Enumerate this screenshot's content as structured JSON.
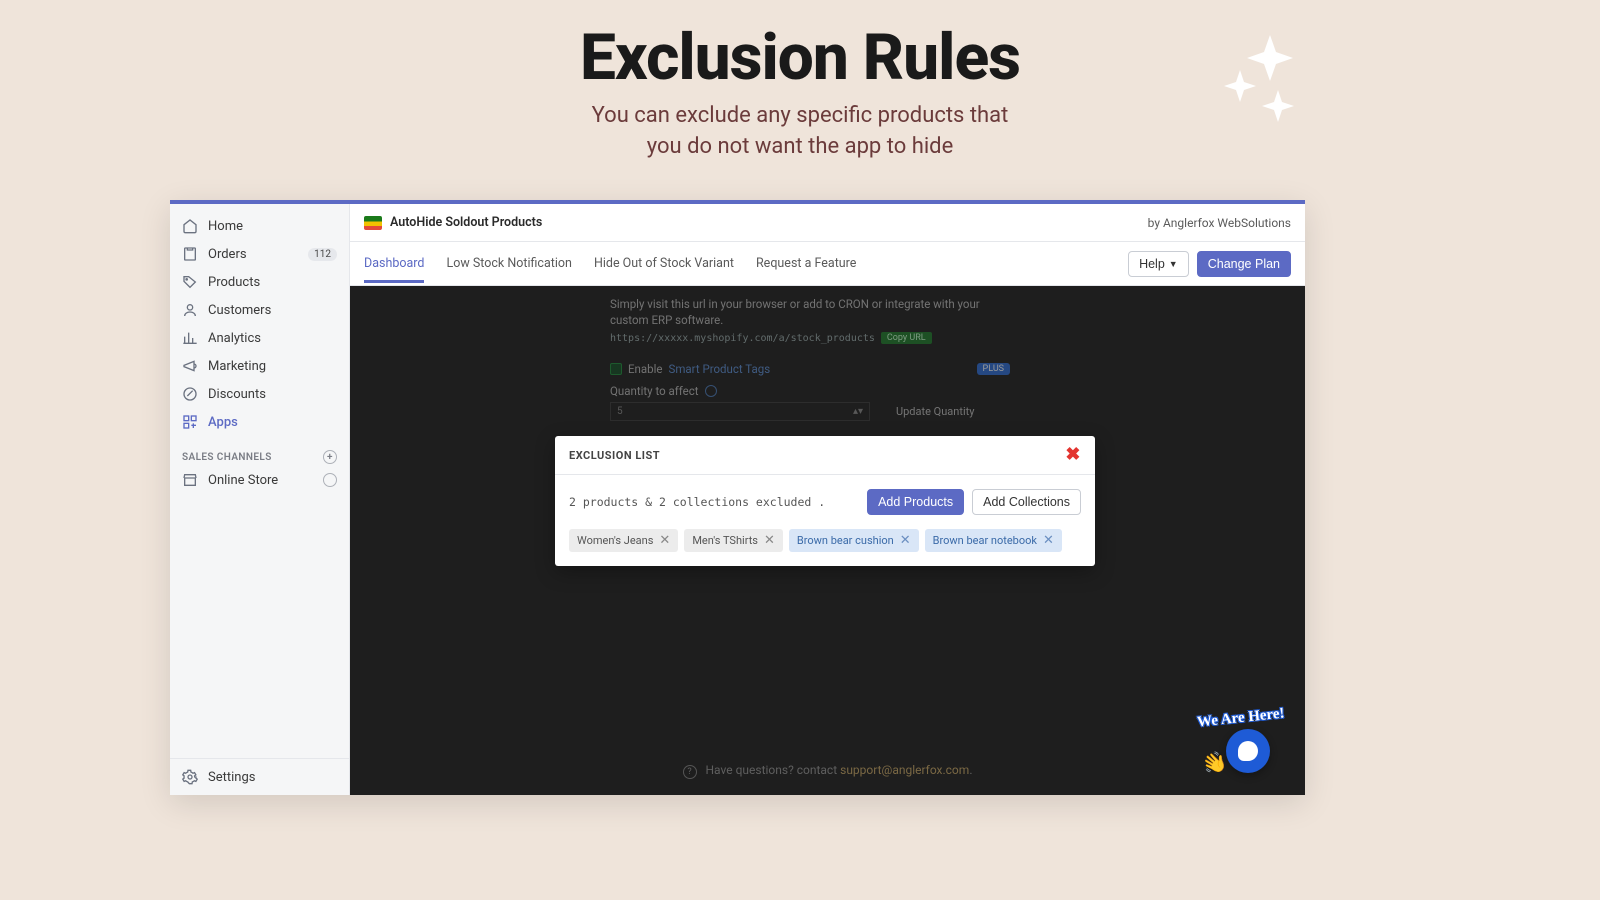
{
  "hero": {
    "title": "Exclusion Rules",
    "sub1": "You can exclude any specific products that",
    "sub2": "you do not want the app to hide"
  },
  "sidebar": {
    "items": [
      {
        "label": "Home"
      },
      {
        "label": "Orders",
        "badge": "112"
      },
      {
        "label": "Products"
      },
      {
        "label": "Customers"
      },
      {
        "label": "Analytics"
      },
      {
        "label": "Marketing"
      },
      {
        "label": "Discounts"
      },
      {
        "label": "Apps"
      }
    ],
    "section_label": "SALES CHANNELS",
    "channels": [
      {
        "label": "Online Store"
      }
    ],
    "settings_label": "Settings"
  },
  "topbar": {
    "app_title": "AutoHide Soldout Products",
    "vendor": "by Anglerfox WebSolutions"
  },
  "tabs": {
    "items": [
      "Dashboard",
      "Low Stock Notification",
      "Hide Out of Stock Variant",
      "Request a Feature"
    ],
    "help_label": "Help",
    "change_plan_label": "Change Plan"
  },
  "backdrop": {
    "line1": "Simply visit this url in your browser or add to CRON or integrate with your custom ERP software.",
    "code": "https://xxxxx.myshopify.com/a/stock_products",
    "copy_label": "Copy URL",
    "enable_label": "Enable",
    "smart_tags": "Smart Product Tags",
    "plus_badge": "PLUS",
    "qty_label": "Quantity to affect",
    "qty_value": "5",
    "update_qty": "Update Quantity",
    "footer_q": "Have questions? contact ",
    "footer_email": "support@anglerfox.com"
  },
  "modal": {
    "title": "EXCLUSION LIST",
    "summary": "2 products & 2 collections excluded .",
    "add_products": "Add Products",
    "add_collections": "Add Collections",
    "chips": [
      {
        "label": "Women's Jeans",
        "type": "gray"
      },
      {
        "label": "Men's TShirts",
        "type": "gray"
      },
      {
        "label": "Brown bear cushion",
        "type": "blue"
      },
      {
        "label": "Brown bear notebook",
        "type": "blue"
      }
    ]
  },
  "chat": {
    "label": "We Are Here!"
  }
}
